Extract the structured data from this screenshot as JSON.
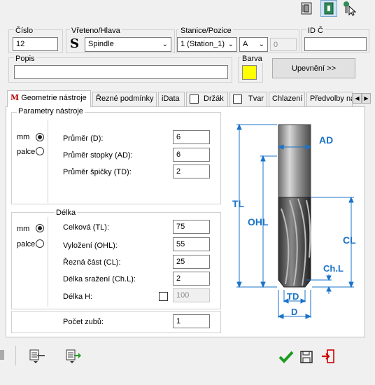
{
  "header": {
    "cislo_label": "Číslo",
    "cislo_value": "12",
    "vreteno_label": "Vřeteno/Hlava",
    "vreteno_value": "Spindle",
    "stanice_label": "Stanice/Pozice",
    "stanice_value": "1 (Station_1)",
    "pozice_value": "A",
    "pozice_number": "0",
    "id_label": "ID Č",
    "id_value": "",
    "popis_label": "Popis",
    "popis_value": "",
    "barva_label": "Barva",
    "barva_color": "#ffff00",
    "upevneni_button": "Upevnění >>"
  },
  "tabs": [
    {
      "label": "Geometrie nástroje"
    },
    {
      "label": "Řezné podmínky"
    },
    {
      "label": "iData"
    },
    {
      "label": "Držák"
    },
    {
      "label": "Tvar"
    },
    {
      "label": "Chlazení"
    },
    {
      "label": "Předvolby ná"
    }
  ],
  "params": {
    "group_title": "Parametry nástroje",
    "unit_mm": "mm",
    "unit_palce": "palce",
    "fields": [
      {
        "label": "Průměr (D):",
        "value": "6"
      },
      {
        "label": "Průměr stopky (AD):",
        "value": "6"
      },
      {
        "label": "Průměr špičky (TD):",
        "value": "2"
      }
    ]
  },
  "length": {
    "group_title": "Délka",
    "unit_mm": "mm",
    "unit_palce": "palce",
    "fields": [
      {
        "label": "Celková (TL):",
        "value": "75"
      },
      {
        "label": "Vyložení (OHL):",
        "value": "55"
      },
      {
        "label": "Řezná část (CL):",
        "value": "25"
      },
      {
        "label": "Délka sražení (Ch.L):",
        "value": "2"
      }
    ],
    "delka_h_label": "Délka H:",
    "delka_h_value": "100"
  },
  "teeth": {
    "label": "Počet zubů:",
    "value": "1"
  },
  "diagram": {
    "ad": "AD",
    "tl": "TL",
    "ohl": "OHL",
    "cl": "CL",
    "chl": "Ch.L",
    "td": "TD",
    "d": "D",
    "dim_color": "#1a73c8"
  },
  "colors": {
    "accent": "#cce4f7"
  }
}
